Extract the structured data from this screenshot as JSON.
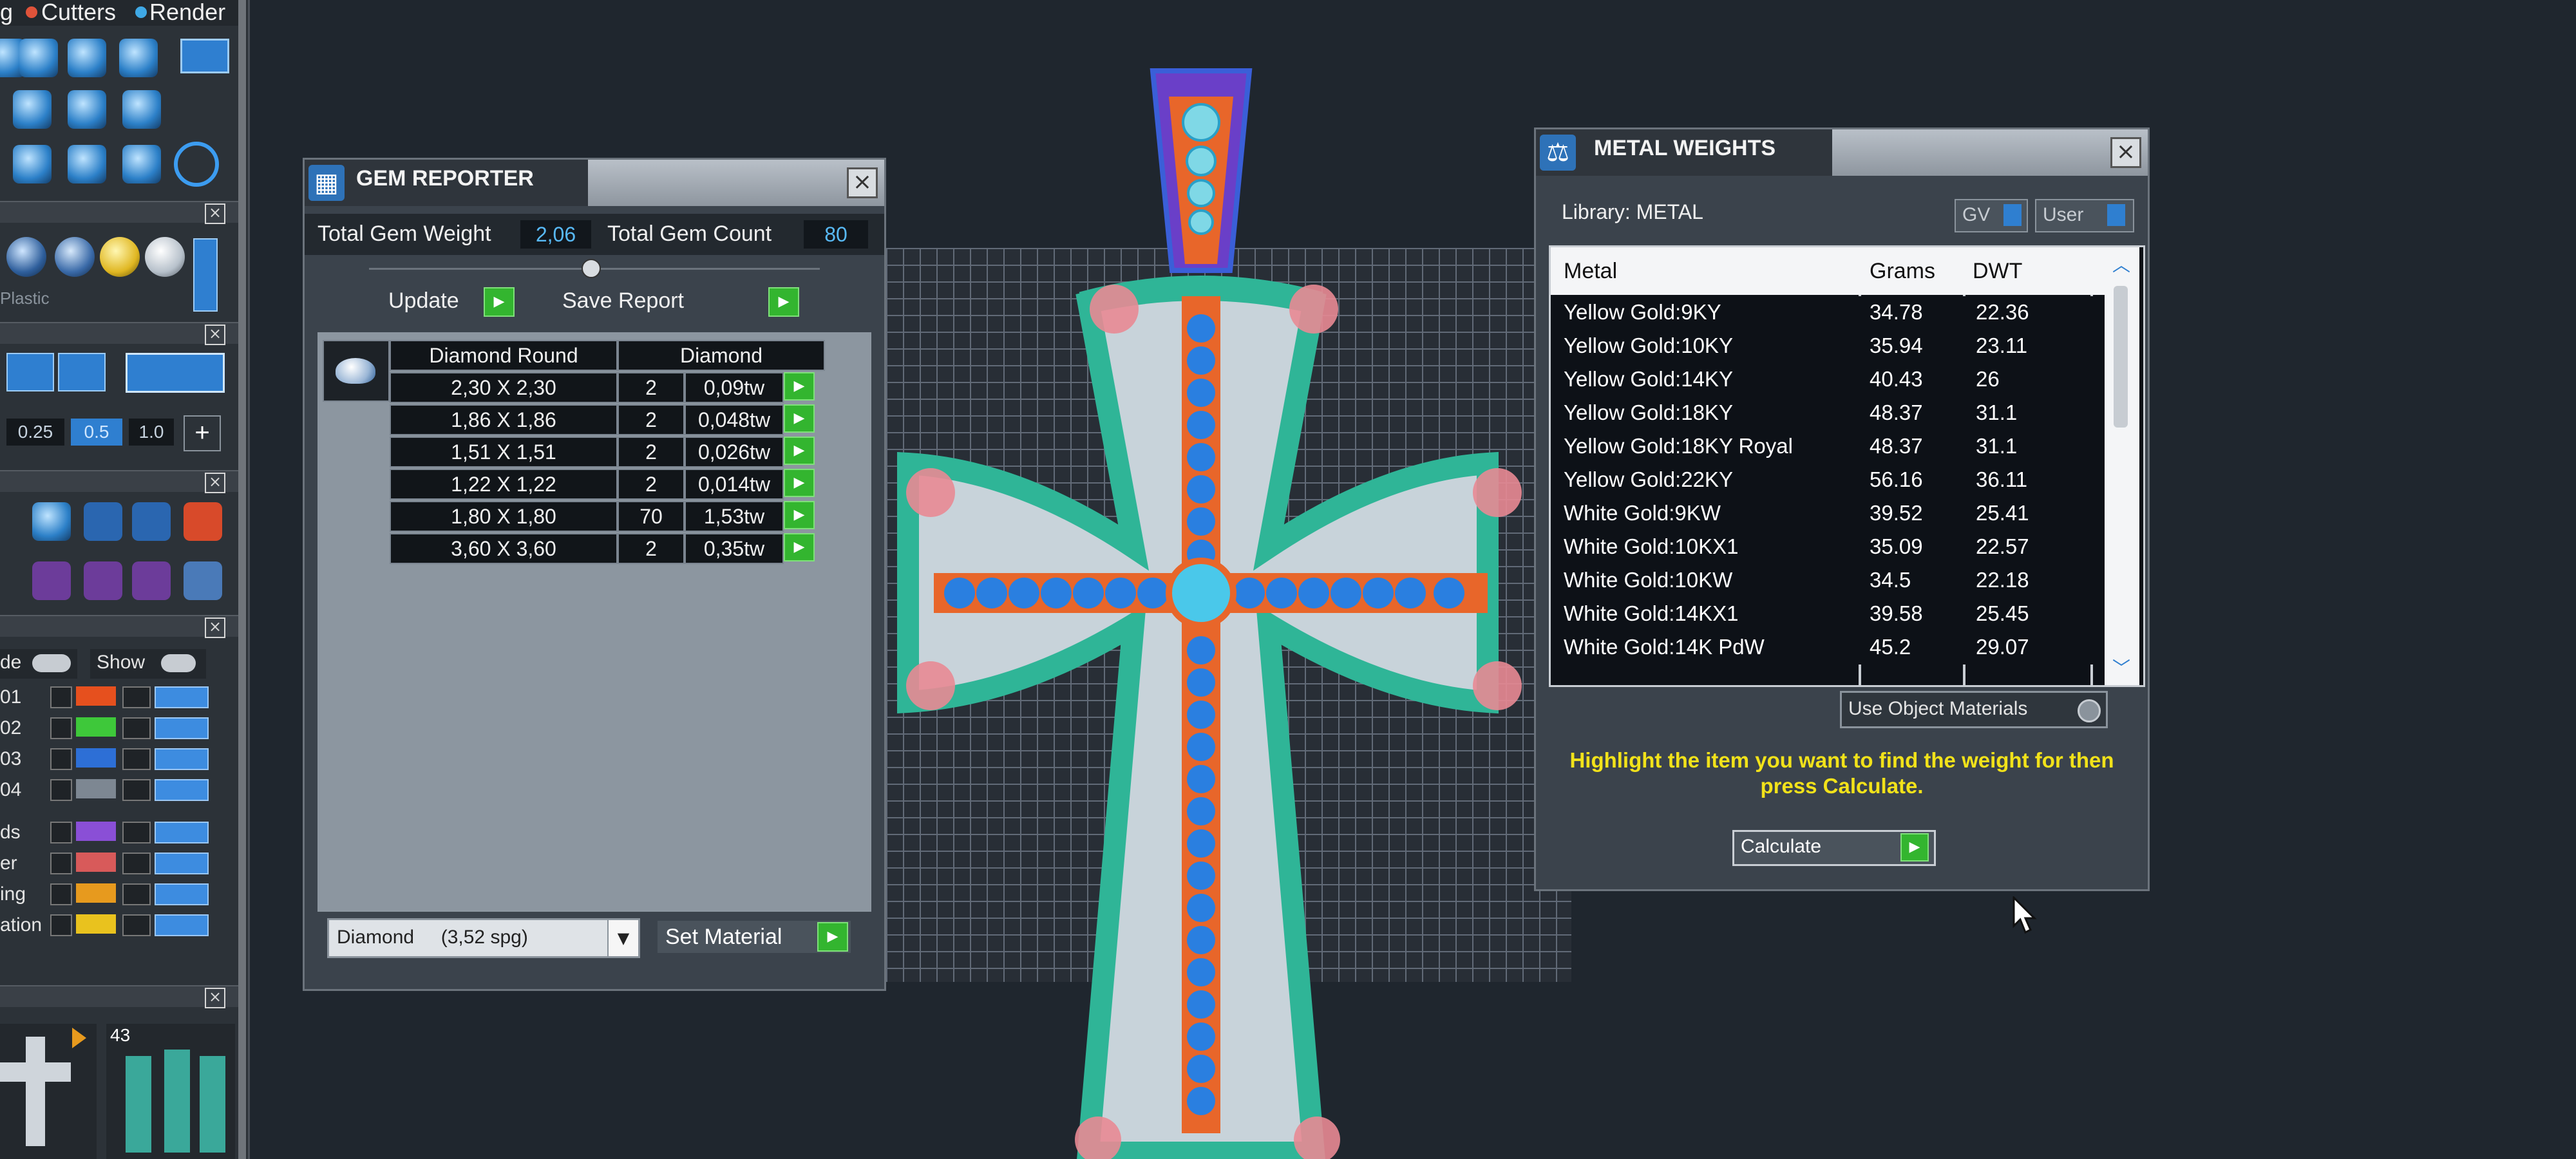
{
  "toolbar": {
    "tabs": [
      "g",
      "Cutters",
      "Render"
    ],
    "dots": {
      "cutters": "#e0533a",
      "render": "#3fa9e6"
    },
    "material_hint": "Plastic",
    "numeric_fields": [
      "0.25",
      "0.5",
      "1.0"
    ],
    "layer_controls": {
      "mode_label": "de",
      "show_label": "Show"
    },
    "layers": [
      {
        "label": "01",
        "color": "#e6501e"
      },
      {
        "label": "02",
        "color": "#3ec83a"
      },
      {
        "label": "03",
        "color": "#2d6fd6"
      },
      {
        "label": "04",
        "color": "#7d8792"
      },
      {
        "label": "ds",
        "color": "#8a4fd6"
      },
      {
        "label": "er",
        "color": "#d85a5a"
      },
      {
        "label": "ing",
        "color": "#e79a1e"
      },
      {
        "label": "ation",
        "color": "#e9c21e"
      }
    ],
    "thumbnail_count": "43"
  },
  "gem_reporter": {
    "title": "GEM REPORTER",
    "total_weight_label": "Total Gem Weight",
    "total_weight_value": "2,06",
    "total_count_label": "Total Gem Count",
    "total_count_value": "80",
    "update_label": "Update",
    "save_label": "Save Report",
    "header_shape": "Diamond Round",
    "header_material": "Diamond",
    "rows": [
      {
        "size": "2,30 X 2,30",
        "count": "2",
        "weight": "0,09tw"
      },
      {
        "size": "1,86 X 1,86",
        "count": "2",
        "weight": "0,048tw"
      },
      {
        "size": "1,51 X 1,51",
        "count": "2",
        "weight": "0,026tw"
      },
      {
        "size": "1,22 X 1,22",
        "count": "2",
        "weight": "0,014tw"
      },
      {
        "size": "1,80 X 1,80",
        "count": "70",
        "weight": "1,53tw"
      },
      {
        "size": "3,60 X 3,60",
        "count": "2",
        "weight": "0,35tw"
      }
    ],
    "material_select": "Diamond     (3,52 spg)",
    "set_material_label": "Set Material"
  },
  "metal_weights": {
    "title": "METAL WEIGHTS",
    "library_label": "Library: METAL",
    "gv_label": "GV",
    "user_label": "User",
    "columns": [
      "Metal",
      "Grams",
      "DWT"
    ],
    "rows": [
      {
        "metal": "Yellow Gold:9KY",
        "grams": "34.78",
        "dwt": "22.36"
      },
      {
        "metal": "Yellow Gold:10KY",
        "grams": "35.94",
        "dwt": "23.11"
      },
      {
        "metal": "Yellow Gold:14KY",
        "grams": "40.43",
        "dwt": "26"
      },
      {
        "metal": "Yellow Gold:18KY",
        "grams": "48.37",
        "dwt": "31.1"
      },
      {
        "metal": "Yellow Gold:18KY Royal",
        "grams": "48.37",
        "dwt": "31.1"
      },
      {
        "metal": "Yellow Gold:22KY",
        "grams": "56.16",
        "dwt": "36.11"
      },
      {
        "metal": "White Gold:9KW",
        "grams": "39.52",
        "dwt": "25.41"
      },
      {
        "metal": "White Gold:10KX1",
        "grams": "35.09",
        "dwt": "22.57"
      },
      {
        "metal": "White Gold:10KW",
        "grams": "34.5",
        "dwt": "22.18"
      },
      {
        "metal": "White Gold:14KX1",
        "grams": "39.58",
        "dwt": "25.45"
      },
      {
        "metal": "White Gold:14K PdW",
        "grams": "45.2",
        "dwt": "29.07"
      }
    ],
    "use_object_materials_label": "Use Object Materials",
    "hint": "Highlight the item you want to find the weight for then press Calculate.",
    "calculate_label": "Calculate",
    "hint_color": "#f2e21a"
  }
}
